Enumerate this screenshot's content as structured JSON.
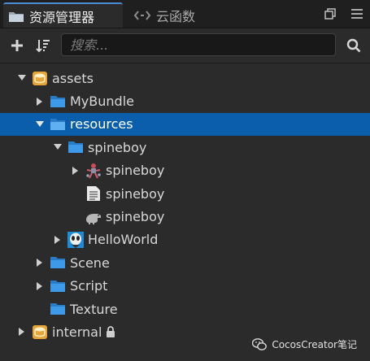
{
  "tabs": [
    {
      "label": "资源管理器",
      "icon": "folder-icon",
      "active": true
    },
    {
      "label": "云函数",
      "icon": "link-icon",
      "active": false
    }
  ],
  "toolbar": {
    "add_icon": "plus-icon",
    "sort_icon": "sort-icon",
    "search_placeholder": "搜索...",
    "search_value": "",
    "search_icon": "search-icon"
  },
  "tree": [
    {
      "label": "assets",
      "icon": "db-icon",
      "arrow": "down",
      "level": 0
    },
    {
      "label": "MyBundle",
      "icon": "folder-icon",
      "arrow": "right",
      "level": 1
    },
    {
      "label": "resources",
      "icon": "folder-icon",
      "arrow": "down",
      "level": 1,
      "selected": true
    },
    {
      "label": "spineboy",
      "icon": "folder-icon",
      "arrow": "down",
      "level": 2
    },
    {
      "label": "spineboy",
      "icon": "spine-skeleton-icon",
      "arrow": "right",
      "level": 3
    },
    {
      "label": "spineboy",
      "icon": "document-icon",
      "arrow": "none",
      "level": 3
    },
    {
      "label": "spineboy",
      "icon": "dino-icon",
      "arrow": "none",
      "level": 3
    },
    {
      "label": "HelloWorld",
      "icon": "image-thumb-icon",
      "arrow": "right",
      "level": 2
    },
    {
      "label": "Scene",
      "icon": "folder-icon",
      "arrow": "right",
      "level": 1
    },
    {
      "label": "Script",
      "icon": "folder-icon",
      "arrow": "right",
      "level": 1
    },
    {
      "label": "Texture",
      "icon": "folder-icon",
      "arrow": "none",
      "level": 1
    },
    {
      "label": "internal",
      "icon": "db-icon",
      "arrow": "right",
      "level": 0,
      "locked": true
    }
  ],
  "watermark": {
    "text": "CocosCreator笔记",
    "icon": "wechat-icon"
  },
  "colors": {
    "accent": "#0a5eab",
    "folder": "#3e9ae8",
    "db": "#e6a53a"
  }
}
